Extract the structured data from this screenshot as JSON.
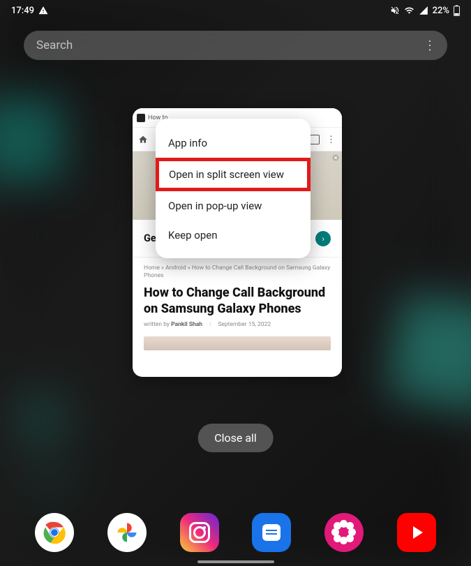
{
  "statusbar": {
    "time": "17:49",
    "battery": "22%"
  },
  "search": {
    "placeholder": "Search"
  },
  "recent": {
    "tab_title": "How to",
    "ad_title": "Get Professional AC Engineers",
    "breadcrumb": "Home » Android » How to Change Call Background on Samsung Galaxy Phones",
    "article_title": "How to Change Call Background on Samsung Galaxy Phones",
    "byline_prefix": "written by",
    "byline_author": "Pankil Shah",
    "byline_date": "September 15, 2022"
  },
  "menu": {
    "app_info": "App info",
    "split": "Open in split screen view",
    "popup": "Open in pop-up view",
    "keep": "Keep open"
  },
  "close_all": "Close all"
}
